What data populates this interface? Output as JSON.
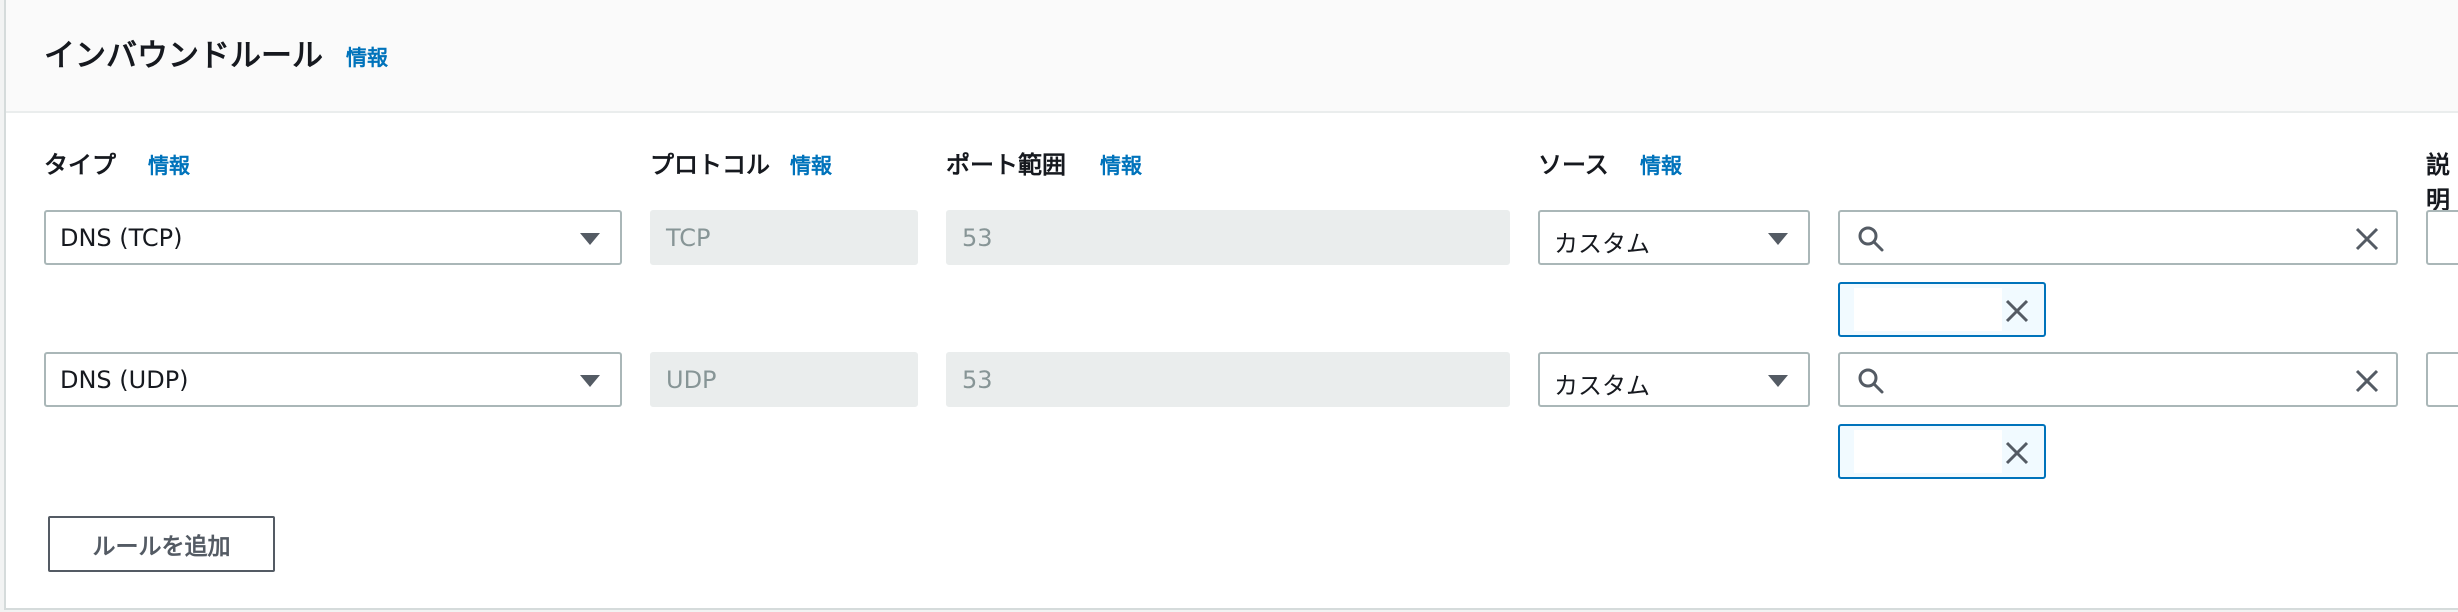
{
  "section": {
    "title": "インバウンドルール",
    "info": "情報"
  },
  "columns": {
    "type": {
      "label": "タイプ",
      "info": "情報"
    },
    "protocol": {
      "label": "プロトコル",
      "info": "情報"
    },
    "port_range": {
      "label": "ポート範囲",
      "info": "情報"
    },
    "source": {
      "label": "ソース",
      "info": "情報"
    },
    "description": {
      "label": "説明"
    }
  },
  "rules": [
    {
      "type": "DNS (TCP)",
      "protocol": "TCP",
      "port_range": "53",
      "source": "カスタム",
      "search_value": ""
    },
    {
      "type": "DNS (UDP)",
      "protocol": "UDP",
      "port_range": "53",
      "source": "カスタム",
      "search_value": ""
    }
  ],
  "add_rule_label": "ルールを追加"
}
